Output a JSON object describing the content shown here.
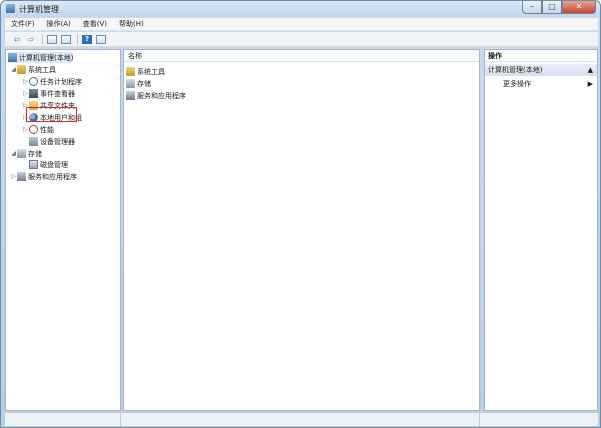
{
  "window": {
    "title": "计算机管理",
    "minimize_label": "–",
    "maximize_label": "□",
    "close_label": "✕"
  },
  "menu": {
    "items": [
      "文件(F)",
      "操作(A)",
      "查看(V)",
      "帮助(H)"
    ]
  },
  "toolbar": {
    "back_label": "⇦",
    "forward_label": "⇨",
    "help_label": "?"
  },
  "tree": {
    "root": "计算机管理(本地)",
    "system_tools": "系统工具",
    "task_scheduler": "任务计划程序",
    "event_viewer": "事件查看器",
    "shared_folders": "共享文件夹",
    "local_users_groups": "本地用户和组",
    "performance": "性能",
    "device_manager": "设备管理器",
    "storage": "存储",
    "disk_management": "磁盘管理",
    "services_apps": "服务和应用程序",
    "expanded_symbol": "◢",
    "collapsed_symbol": "▷"
  },
  "center": {
    "column_name": "名称",
    "items": [
      "系统工具",
      "存储",
      "服务和应用程序"
    ]
  },
  "actions": {
    "header": "操作",
    "section_title": "计算机管理(本地)",
    "section_arrow": "▲",
    "more_actions": "更多操作",
    "more_arrow": "▶"
  }
}
